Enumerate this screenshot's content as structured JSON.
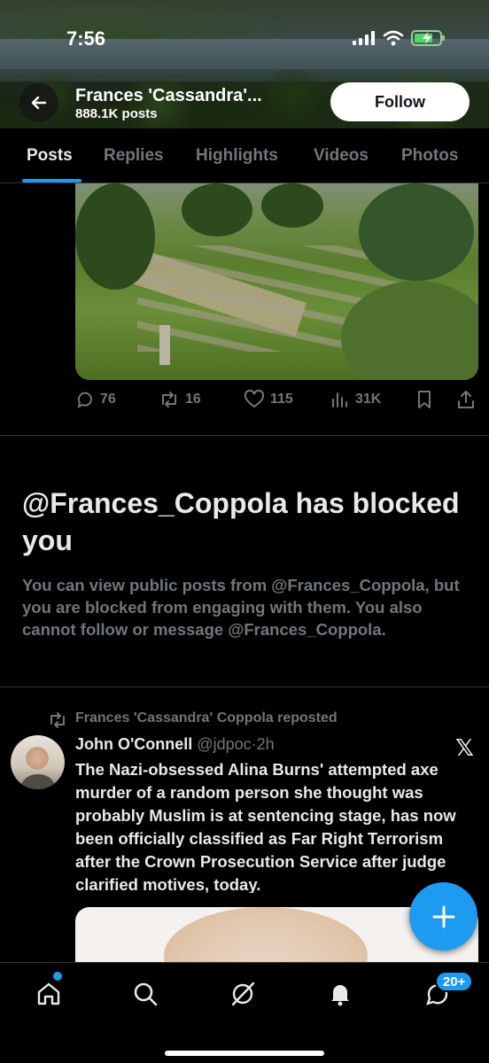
{
  "status_bar": {
    "time": "7:56"
  },
  "header": {
    "profile_name": "Frances 'Cassandra'...",
    "post_count": "888.1K posts",
    "follow_label": "Follow"
  },
  "tabs": [
    {
      "label": "Posts",
      "active": true
    },
    {
      "label": "Replies",
      "active": false
    },
    {
      "label": "Highlights",
      "active": false
    },
    {
      "label": "Videos",
      "active": false
    },
    {
      "label": "Photos",
      "active": false
    }
  ],
  "post_actions": {
    "replies": "76",
    "reposts": "16",
    "likes": "115",
    "views": "31K"
  },
  "blocked_notice": {
    "title": "@Frances_Coppola has blocked you",
    "body": "You can view public posts from @Frances_Coppola, but you are blocked from engaging with them. You also cannot follow or message @Frances_Coppola."
  },
  "repost": {
    "label": "Frances 'Cassandra' Coppola reposted",
    "author_name": "John O'Connell",
    "author_handle": "@jdpoc",
    "separator": "·",
    "time": "2h",
    "text": "The Nazi-obsessed Alina Burns' attempted axe murder of a random person she thought was probably Muslim is at sentencing stage, has now been officially classified as Far Right Terrorism after the Crown Prosecution Service after judge clarified motives, today."
  },
  "bottom_nav": {
    "messages_badge": "20+"
  },
  "colors": {
    "accent": "#1d9bf0",
    "muted": "#71767b",
    "text": "#e7e9ea",
    "background": "#000000"
  }
}
